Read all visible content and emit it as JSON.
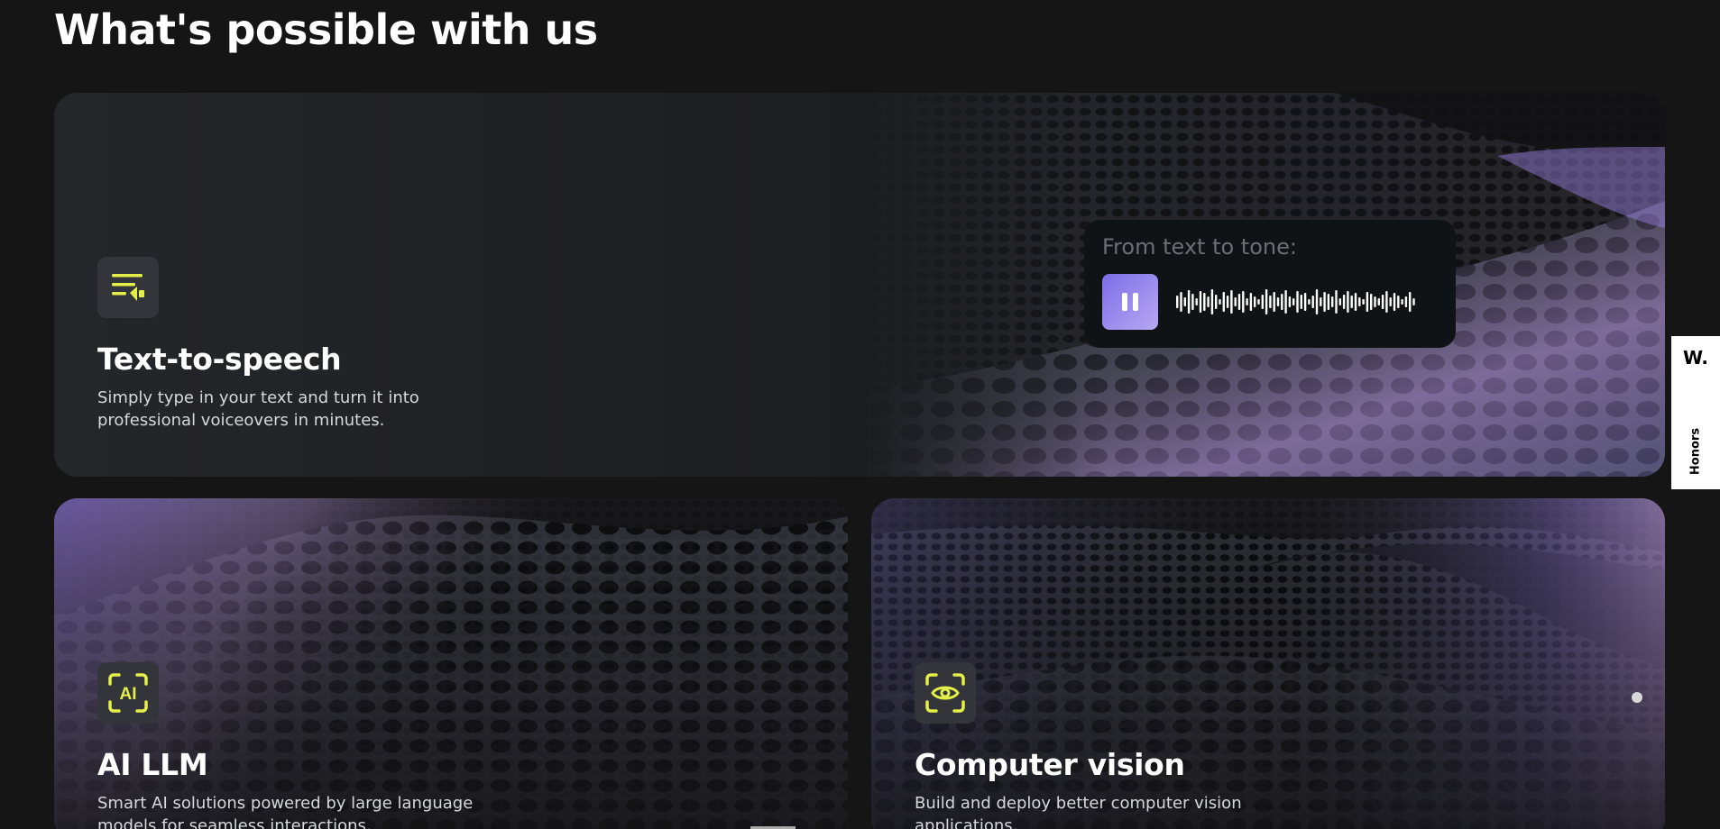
{
  "section": {
    "title": "What's possible with us"
  },
  "cards": {
    "tts": {
      "title": "Text-to-speech",
      "description": "Simply type in your text and turn it into professional voiceovers in minutes.",
      "icon": "text-to-speech-icon",
      "player": {
        "label": "From text to tone:",
        "state": "playing",
        "button_icon": "pause-icon"
      }
    },
    "llm": {
      "title": "AI LLM",
      "description": "Smart AI solutions powered by large language models for seamless interactions.",
      "icon": "ai-scan-icon",
      "icon_text": "AI"
    },
    "cv": {
      "title": "Computer vision",
      "description": "Build and deploy better computer vision applications.",
      "icon": "eye-scan-icon"
    }
  },
  "honors_tab": {
    "logo": "W.",
    "label": "Honors"
  },
  "colors": {
    "accent_yellow": "#e4f04a",
    "accent_purple": "#9a86ee",
    "background": "#151516",
    "card": "#1f2023"
  }
}
